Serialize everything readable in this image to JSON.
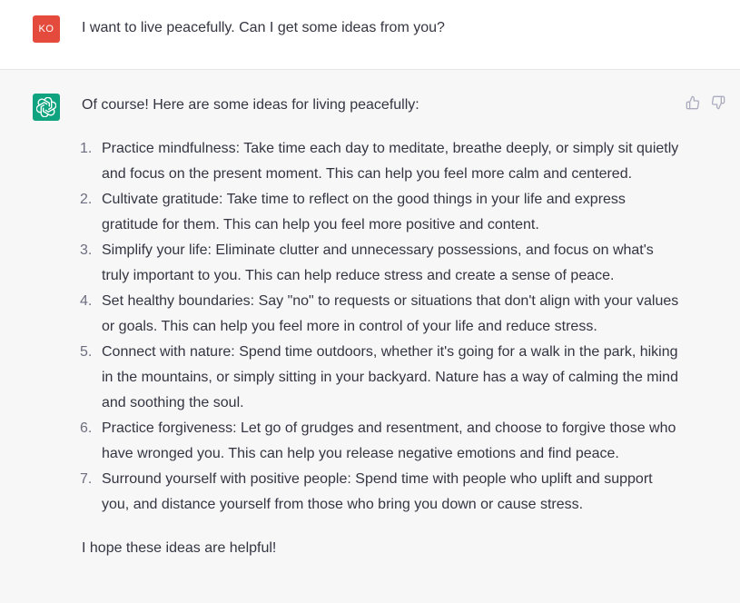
{
  "user_message": {
    "avatar_initials": "KO",
    "text": "I want to live peacefully. Can I get some ideas from you?"
  },
  "assistant_message": {
    "avatar_icon": "openai-logo-icon",
    "intro": "Of course! Here are some ideas for living peacefully:",
    "items": [
      {
        "number": "1.",
        "text": "Practice mindfulness: Take time each day to meditate, breathe deeply, or simply sit quietly and focus on the present moment. This can help you feel more calm and centered."
      },
      {
        "number": "2.",
        "text": "Cultivate gratitude: Take time to reflect on the good things in your life and express gratitude for them. This can help you feel more positive and content."
      },
      {
        "number": "3.",
        "text": "Simplify your life: Eliminate clutter and unnecessary possessions, and focus on what's truly important to you. This can help reduce stress and create a sense of peace."
      },
      {
        "number": "4.",
        "text": "Set healthy boundaries: Say \"no\" to requests or situations that don't align with your values or goals. This can help you feel more in control of your life and reduce stress."
      },
      {
        "number": "5.",
        "text": "Connect with nature: Spend time outdoors, whether it's going for a walk in the park, hiking in the mountains, or simply sitting in your backyard. Nature has a way of calming the mind and soothing the soul."
      },
      {
        "number": "6.",
        "text": "Practice forgiveness: Let go of grudges and resentment, and choose to forgive those who have wronged you. This can help you release negative emotions and find peace."
      },
      {
        "number": "7.",
        "text": "Surround yourself with positive people: Spend time with people who uplift and support you, and distance yourself from those who bring you down or cause stress."
      }
    ],
    "outro": "I hope these ideas are helpful!",
    "feedback": {
      "thumbs_up_icon": "thumbs-up-icon",
      "thumbs_down_icon": "thumbs-down-icon"
    }
  },
  "colors": {
    "user_avatar_bg": "#e54b3c",
    "assistant_avatar_bg": "#10a37f",
    "assistant_row_bg": "#f7f7f8",
    "text": "#343541"
  }
}
